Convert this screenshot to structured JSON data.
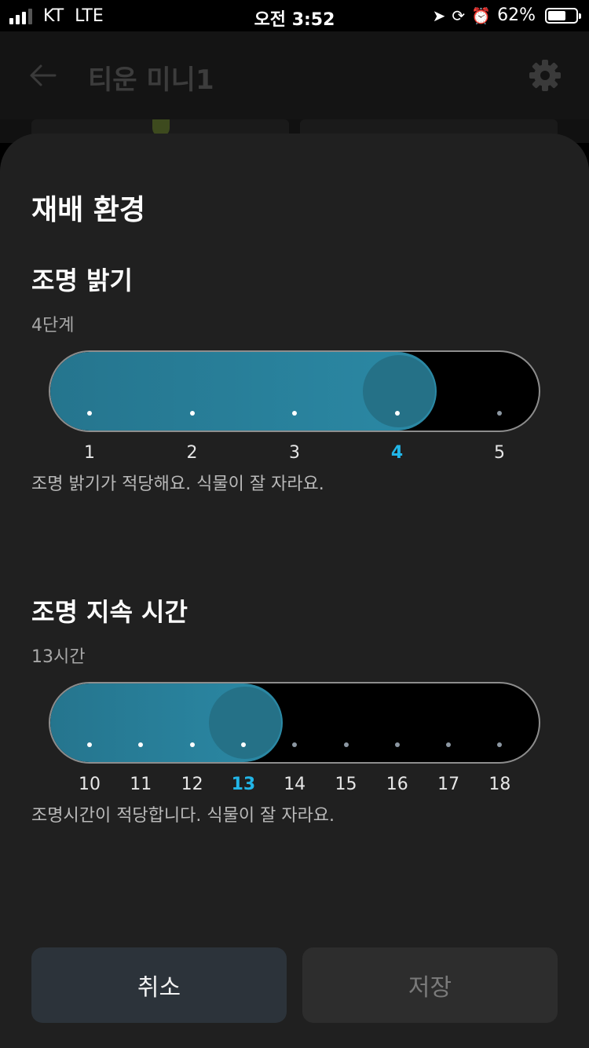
{
  "status_bar": {
    "carrier": "KT",
    "network": "LTE",
    "time": "오전 3:52",
    "battery": "62%"
  },
  "app_bar": {
    "title": "티운 미니1"
  },
  "sheet": {
    "title": "재배 환경",
    "brightness": {
      "title": "조명 밝기",
      "value_text": "4단계",
      "steps": [
        "1",
        "2",
        "3",
        "4",
        "5"
      ],
      "selected_index": 3,
      "message": "조명 밝기가 적당해요. 식물이 잘 자라요."
    },
    "duration": {
      "title": "조명 지속 시간",
      "value_text": "13시간",
      "steps": [
        "10",
        "11",
        "12",
        "13",
        "14",
        "15",
        "16",
        "17",
        "18"
      ],
      "selected_index": 3,
      "message": "조명시간이 적당합니다. 식물이 잘 자라요."
    },
    "buttons": {
      "cancel": "취소",
      "save": "저장"
    }
  },
  "colors": {
    "accent": "#22b6e8",
    "slider_fill": "#2b89a5",
    "sheet_bg": "#202020"
  }
}
